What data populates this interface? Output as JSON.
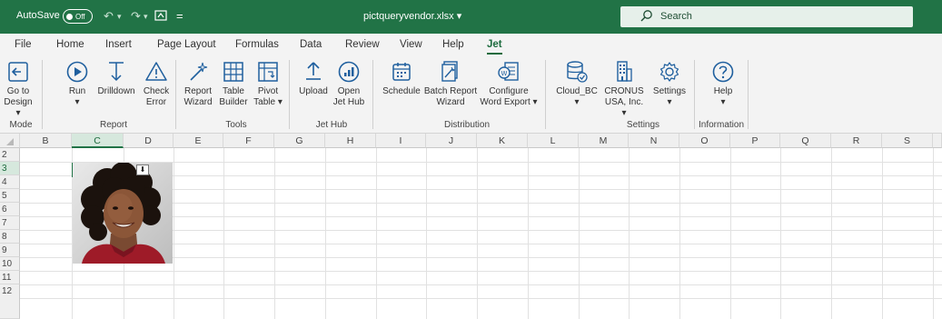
{
  "titlebar": {
    "autosave_label": "AutoSave",
    "autosave_state": "Off",
    "filename": "pictqueryvendor.xlsx",
    "filename_caret": "▾",
    "search_placeholder": "Search",
    "qat_separator": "="
  },
  "menu": {
    "tabs": [
      "File",
      "Home",
      "Insert",
      "Page Layout",
      "Formulas",
      "Data",
      "Review",
      "View",
      "Help",
      "Jet"
    ],
    "active": "Jet"
  },
  "ribbon": {
    "buttons": {
      "go_to_design": "Go to\nDesign ▾",
      "run": "Run\n▾",
      "drilldown": "Drilldown",
      "check_error": "Check\nError",
      "report_wizard": "Report\nWizard",
      "table_builder": "Table\nBuilder",
      "pivot_table": "Pivot\nTable ▾",
      "upload": "Upload",
      "open_jet_hub": "Open\nJet Hub",
      "schedule": "Schedule",
      "batch_report_wizard": "Batch Report\nWizard",
      "configure_word_export": "Configure\nWord Export ▾",
      "cloud_bc": "Cloud_BC\n▾",
      "cronus": "CRONUS\nUSA, Inc. ▾",
      "settings": "Settings\n▾",
      "help": "Help\n▾"
    },
    "groups": {
      "mode": "Mode",
      "report": "Report",
      "tools": "Tools",
      "jet_hub": "Jet Hub",
      "distribution": "Distribution",
      "settings": "Settings",
      "information": "Information"
    }
  },
  "grid": {
    "columns": [
      "B",
      "C",
      "D",
      "E",
      "F",
      "G",
      "H",
      "I",
      "J",
      "K",
      "L",
      "M",
      "N",
      "O",
      "P",
      "Q",
      "R",
      "S"
    ],
    "rows": [
      "2",
      "3",
      "4",
      "5",
      "6",
      "7",
      "8",
      "9",
      "10",
      "11",
      "12"
    ],
    "selected_column": "C",
    "selected_row": "3"
  },
  "colors": {
    "brand": "#217346",
    "ribbon_bg": "#f3f3f3"
  }
}
